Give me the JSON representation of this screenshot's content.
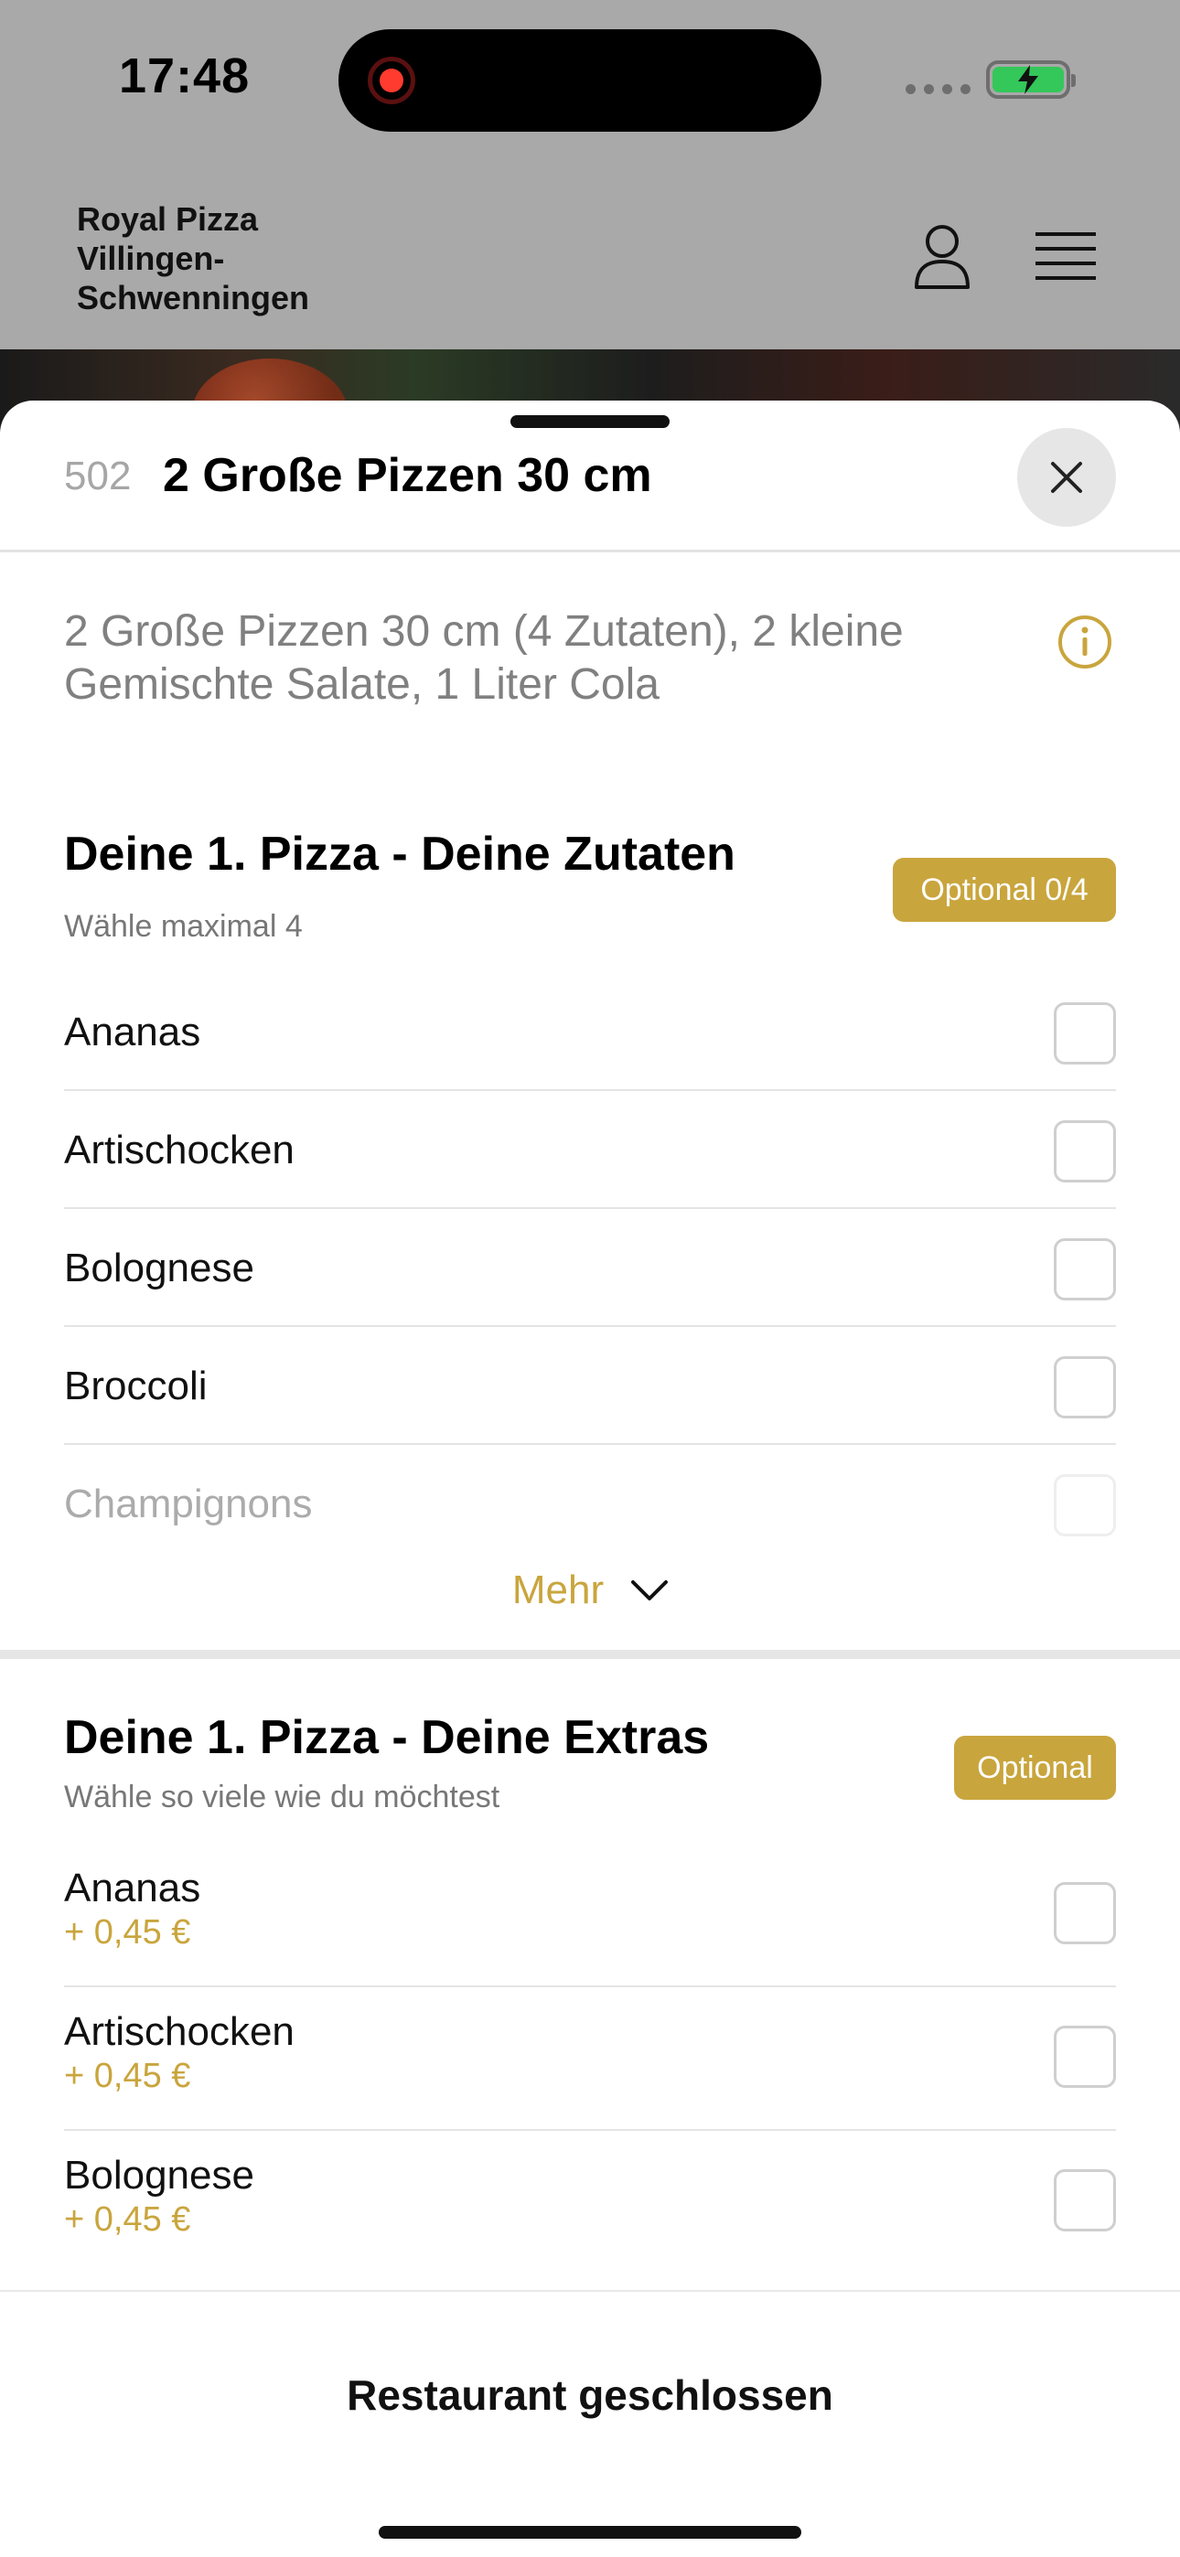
{
  "status_bar": {
    "time": "17:48"
  },
  "header": {
    "restaurant_name": "Royal Pizza Villingen-Schwenningen",
    "user_icon": "user-icon",
    "menu_icon": "hamburger-menu-icon"
  },
  "sheet": {
    "item_number": "502",
    "item_title": "2 Große Pizzen 30 cm",
    "description": "2 Große Pizzen 30 cm (4 Zutaten), 2 kleine Gemischte Salate, 1 Liter Cola",
    "sections": [
      {
        "title": "Deine 1. Pizza - Deine Zutaten",
        "subtitle": "Wähle maximal 4",
        "badge": "Optional 0/4",
        "options": [
          {
            "label": "Ananas",
            "checked": false
          },
          {
            "label": "Artischocken",
            "checked": false
          },
          {
            "label": "Bolognese",
            "checked": false
          },
          {
            "label": "Broccoli",
            "checked": false
          },
          {
            "label": "Champignons",
            "checked": false
          }
        ],
        "more_label": "Mehr"
      },
      {
        "title": "Deine 1. Pizza - Deine Extras",
        "subtitle": "Wähle so viele wie du möchtest",
        "badge": "Optional",
        "options": [
          {
            "label": "Ananas",
            "price": "+ 0,45 €",
            "checked": false
          },
          {
            "label": "Artischocken",
            "price": "+ 0,45 €",
            "checked": false
          },
          {
            "label": "Bolognese",
            "price": "+ 0,45 €",
            "checked": false
          }
        ]
      }
    ],
    "footer": "Restaurant geschlossen"
  },
  "colors": {
    "accent": "#c9a53d",
    "overlay": "#a9a9a9"
  }
}
